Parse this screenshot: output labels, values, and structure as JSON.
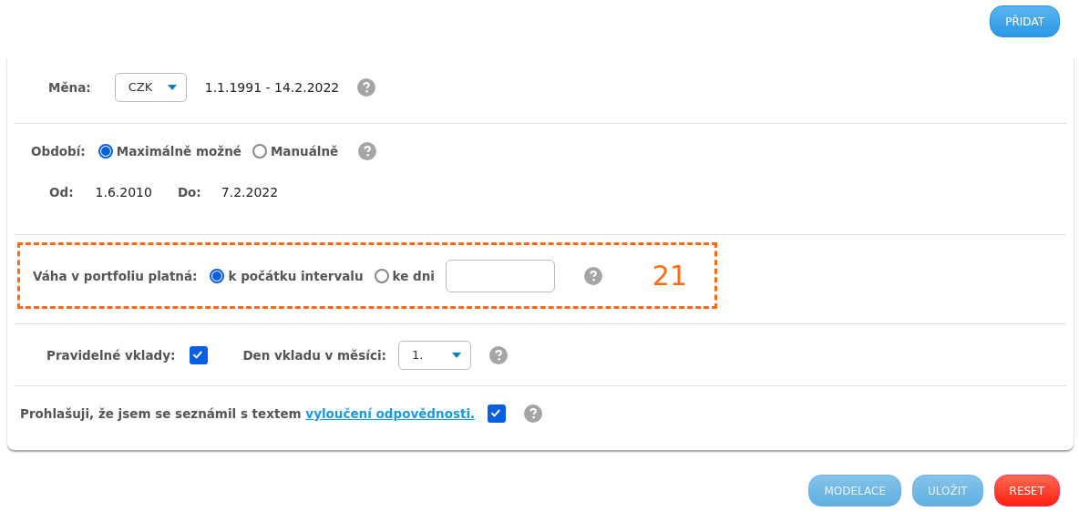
{
  "add_button": {
    "label": "PŘIDAT",
    "disabled": false
  },
  "currency": {
    "label": "Měna:",
    "value": "CZK",
    "range": "1.1.1991 - 14.2.2022"
  },
  "period": {
    "label": "Období:",
    "options": [
      {
        "label": "Maximálně možné",
        "selected": true
      },
      {
        "label": "Manuálně",
        "selected": false
      }
    ],
    "from_label": "Od:",
    "from": "1.6.2010",
    "to_label": "Do:",
    "to": "7.2.2022"
  },
  "weight": {
    "label": "Váha v portfoliu platná:",
    "options": [
      {
        "label": "k počátku intervalu",
        "selected": true
      },
      {
        "label": "ke dni",
        "selected": false
      }
    ],
    "annotation": "21"
  },
  "deposits": {
    "label": "Pravidelné vklady:",
    "checked": true,
    "day_label": "Den vkladu v měsíci:",
    "day": "1."
  },
  "disclaimer": {
    "text": "Prohlašuji, že jsem se seznámil s textem",
    "link": "vyloučení odpovědnosti.",
    "checked": true
  },
  "buttons": [
    {
      "label": "MODELACE",
      "kind": "primary",
      "disabled": true
    },
    {
      "label": "ULOŽIT",
      "kind": "primary",
      "disabled": true
    },
    {
      "label": "RESET",
      "kind": "danger",
      "disabled": false
    }
  ]
}
